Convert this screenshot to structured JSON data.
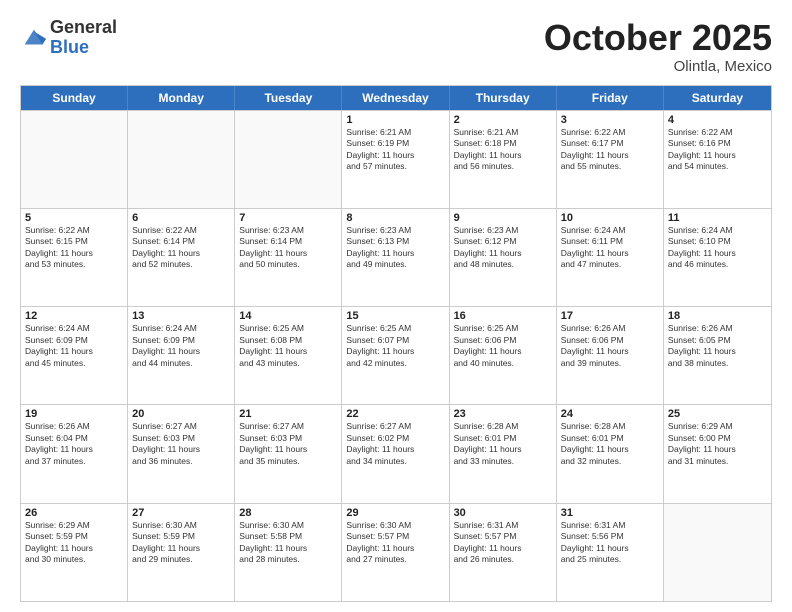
{
  "logo": {
    "general": "General",
    "blue": "Blue"
  },
  "title": "October 2025",
  "subtitle": "Olintla, Mexico",
  "header": {
    "days": [
      "Sunday",
      "Monday",
      "Tuesday",
      "Wednesday",
      "Thursday",
      "Friday",
      "Saturday"
    ]
  },
  "weeks": [
    [
      {
        "day": "",
        "info": ""
      },
      {
        "day": "",
        "info": ""
      },
      {
        "day": "",
        "info": ""
      },
      {
        "day": "1",
        "info": "Sunrise: 6:21 AM\nSunset: 6:19 PM\nDaylight: 11 hours\nand 57 minutes."
      },
      {
        "day": "2",
        "info": "Sunrise: 6:21 AM\nSunset: 6:18 PM\nDaylight: 11 hours\nand 56 minutes."
      },
      {
        "day": "3",
        "info": "Sunrise: 6:22 AM\nSunset: 6:17 PM\nDaylight: 11 hours\nand 55 minutes."
      },
      {
        "day": "4",
        "info": "Sunrise: 6:22 AM\nSunset: 6:16 PM\nDaylight: 11 hours\nand 54 minutes."
      }
    ],
    [
      {
        "day": "5",
        "info": "Sunrise: 6:22 AM\nSunset: 6:15 PM\nDaylight: 11 hours\nand 53 minutes."
      },
      {
        "day": "6",
        "info": "Sunrise: 6:22 AM\nSunset: 6:14 PM\nDaylight: 11 hours\nand 52 minutes."
      },
      {
        "day": "7",
        "info": "Sunrise: 6:23 AM\nSunset: 6:14 PM\nDaylight: 11 hours\nand 50 minutes."
      },
      {
        "day": "8",
        "info": "Sunrise: 6:23 AM\nSunset: 6:13 PM\nDaylight: 11 hours\nand 49 minutes."
      },
      {
        "day": "9",
        "info": "Sunrise: 6:23 AM\nSunset: 6:12 PM\nDaylight: 11 hours\nand 48 minutes."
      },
      {
        "day": "10",
        "info": "Sunrise: 6:24 AM\nSunset: 6:11 PM\nDaylight: 11 hours\nand 47 minutes."
      },
      {
        "day": "11",
        "info": "Sunrise: 6:24 AM\nSunset: 6:10 PM\nDaylight: 11 hours\nand 46 minutes."
      }
    ],
    [
      {
        "day": "12",
        "info": "Sunrise: 6:24 AM\nSunset: 6:09 PM\nDaylight: 11 hours\nand 45 minutes."
      },
      {
        "day": "13",
        "info": "Sunrise: 6:24 AM\nSunset: 6:09 PM\nDaylight: 11 hours\nand 44 minutes."
      },
      {
        "day": "14",
        "info": "Sunrise: 6:25 AM\nSunset: 6:08 PM\nDaylight: 11 hours\nand 43 minutes."
      },
      {
        "day": "15",
        "info": "Sunrise: 6:25 AM\nSunset: 6:07 PM\nDaylight: 11 hours\nand 42 minutes."
      },
      {
        "day": "16",
        "info": "Sunrise: 6:25 AM\nSunset: 6:06 PM\nDaylight: 11 hours\nand 40 minutes."
      },
      {
        "day": "17",
        "info": "Sunrise: 6:26 AM\nSunset: 6:06 PM\nDaylight: 11 hours\nand 39 minutes."
      },
      {
        "day": "18",
        "info": "Sunrise: 6:26 AM\nSunset: 6:05 PM\nDaylight: 11 hours\nand 38 minutes."
      }
    ],
    [
      {
        "day": "19",
        "info": "Sunrise: 6:26 AM\nSunset: 6:04 PM\nDaylight: 11 hours\nand 37 minutes."
      },
      {
        "day": "20",
        "info": "Sunrise: 6:27 AM\nSunset: 6:03 PM\nDaylight: 11 hours\nand 36 minutes."
      },
      {
        "day": "21",
        "info": "Sunrise: 6:27 AM\nSunset: 6:03 PM\nDaylight: 11 hours\nand 35 minutes."
      },
      {
        "day": "22",
        "info": "Sunrise: 6:27 AM\nSunset: 6:02 PM\nDaylight: 11 hours\nand 34 minutes."
      },
      {
        "day": "23",
        "info": "Sunrise: 6:28 AM\nSunset: 6:01 PM\nDaylight: 11 hours\nand 33 minutes."
      },
      {
        "day": "24",
        "info": "Sunrise: 6:28 AM\nSunset: 6:01 PM\nDaylight: 11 hours\nand 32 minutes."
      },
      {
        "day": "25",
        "info": "Sunrise: 6:29 AM\nSunset: 6:00 PM\nDaylight: 11 hours\nand 31 minutes."
      }
    ],
    [
      {
        "day": "26",
        "info": "Sunrise: 6:29 AM\nSunset: 5:59 PM\nDaylight: 11 hours\nand 30 minutes."
      },
      {
        "day": "27",
        "info": "Sunrise: 6:30 AM\nSunset: 5:59 PM\nDaylight: 11 hours\nand 29 minutes."
      },
      {
        "day": "28",
        "info": "Sunrise: 6:30 AM\nSunset: 5:58 PM\nDaylight: 11 hours\nand 28 minutes."
      },
      {
        "day": "29",
        "info": "Sunrise: 6:30 AM\nSunset: 5:57 PM\nDaylight: 11 hours\nand 27 minutes."
      },
      {
        "day": "30",
        "info": "Sunrise: 6:31 AM\nSunset: 5:57 PM\nDaylight: 11 hours\nand 26 minutes."
      },
      {
        "day": "31",
        "info": "Sunrise: 6:31 AM\nSunset: 5:56 PM\nDaylight: 11 hours\nand 25 minutes."
      },
      {
        "day": "",
        "info": ""
      }
    ]
  ]
}
